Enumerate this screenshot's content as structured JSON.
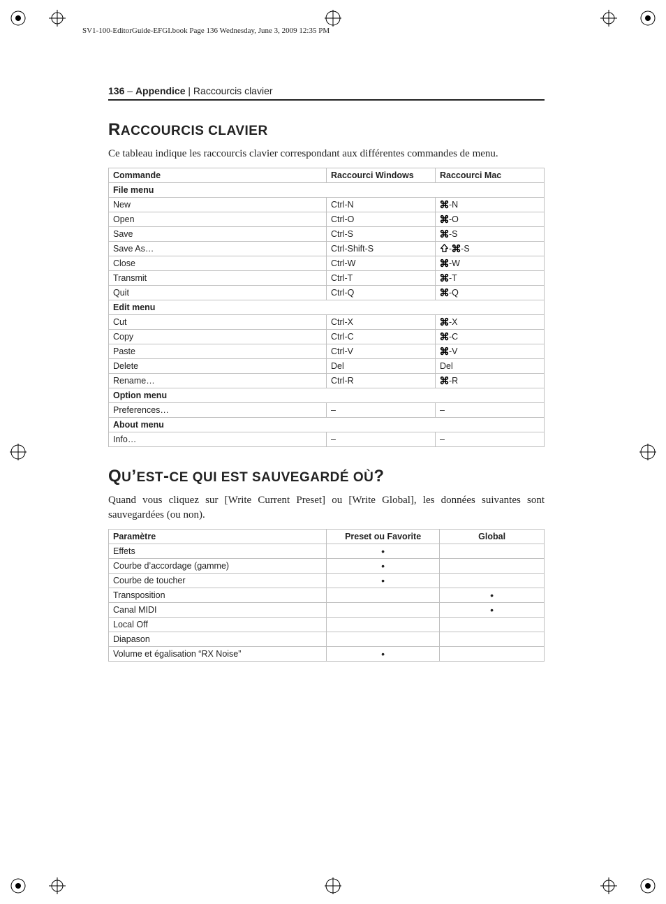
{
  "slug": "SV1-100-EditorGuide-EFGI.book  Page 136  Wednesday, June 3, 2009  12:35 PM",
  "runhead": {
    "page": "136",
    "sep": " – ",
    "bold": "Appendice",
    "rest": " | Raccourcis clavier"
  },
  "section1": {
    "title_big": "R",
    "title_small": "ACCOURCIS CLAVIER",
    "intro": "Ce tableau indique les raccourcis clavier correspondant aux différentes commandes de menu."
  },
  "table1": {
    "h1": "Commande",
    "h2": "Raccourci Windows",
    "h3": "Raccourci Mac",
    "groups": [
      {
        "label": "File menu",
        "rows": [
          {
            "cmd": "New",
            "win": "Ctrl-N",
            "mac": {
              "mods": [
                "cmd"
              ],
              "key": "-N"
            }
          },
          {
            "cmd": "Open",
            "win": "Ctrl-O",
            "mac": {
              "mods": [
                "cmd"
              ],
              "key": "-O"
            }
          },
          {
            "cmd": "Save",
            "win": "Ctrl-S",
            "mac": {
              "mods": [
                "cmd"
              ],
              "key": "-S"
            }
          },
          {
            "cmd": "Save As…",
            "win": "Ctrl-Shift-S",
            "mac": {
              "mods": [
                "shift",
                "cmd"
              ],
              "key": "-S"
            }
          },
          {
            "cmd": "Close",
            "win": "Ctrl-W",
            "mac": {
              "mods": [
                "cmd"
              ],
              "key": "-W"
            }
          },
          {
            "cmd": "Transmit",
            "win": "Ctrl-T",
            "mac": {
              "mods": [
                "cmd"
              ],
              "key": "-T"
            }
          },
          {
            "cmd": "Quit",
            "win": "Ctrl-Q",
            "mac": {
              "mods": [
                "cmd"
              ],
              "key": "-Q"
            }
          }
        ]
      },
      {
        "label": "Edit menu",
        "rows": [
          {
            "cmd": "Cut",
            "win": "Ctrl-X",
            "mac": {
              "mods": [
                "cmd"
              ],
              "key": "-X"
            }
          },
          {
            "cmd": "Copy",
            "win": "Ctrl-C",
            "mac": {
              "mods": [
                "cmd"
              ],
              "key": "-C"
            }
          },
          {
            "cmd": "Paste",
            "win": "Ctrl-V",
            "mac": {
              "mods": [
                "cmd"
              ],
              "key": "-V"
            }
          },
          {
            "cmd": "Delete",
            "win": "Del",
            "mac": {
              "text": "Del"
            }
          },
          {
            "cmd": "Rename…",
            "win": "Ctrl-R",
            "mac": {
              "mods": [
                "cmd"
              ],
              "key": "-R"
            }
          }
        ]
      },
      {
        "label": "Option menu",
        "rows": [
          {
            "cmd": "Preferences…",
            "win": "–",
            "mac": {
              "text": "–"
            }
          }
        ]
      },
      {
        "label": "About menu",
        "rows": [
          {
            "cmd": "Info…",
            "win": "–",
            "mac": {
              "text": "–"
            }
          }
        ]
      }
    ]
  },
  "section2": {
    "title_big1": "Q",
    "title_small1": "U",
    "apos": "’",
    "title_small2": "EST",
    "hyph": "-",
    "title_small3": "CE QUI EST SAUVEGARDÉ OÙ",
    "q": "?",
    "intro": "Quand vous cliquez sur [Write Current Preset] ou [Write Global], les données suivantes sont sauvegardées (ou non)."
  },
  "table2": {
    "h1": "Paramètre",
    "h2": "Preset ou Favorite",
    "h3": "Global",
    "rows": [
      {
        "p": "Effets",
        "preset": true,
        "global": false
      },
      {
        "p": "Courbe d’accordage (gamme)",
        "preset": true,
        "global": false
      },
      {
        "p": "Courbe de toucher",
        "preset": true,
        "global": false
      },
      {
        "p": "Transposition",
        "preset": false,
        "global": true
      },
      {
        "p": "Canal MIDI",
        "preset": false,
        "global": true
      },
      {
        "p": "Local Off",
        "preset": false,
        "global": false
      },
      {
        "p": "Diapason",
        "preset": false,
        "global": false
      },
      {
        "p": "Volume et égalisation “RX Noise”",
        "preset": true,
        "global": false
      }
    ]
  },
  "bullet": "•"
}
